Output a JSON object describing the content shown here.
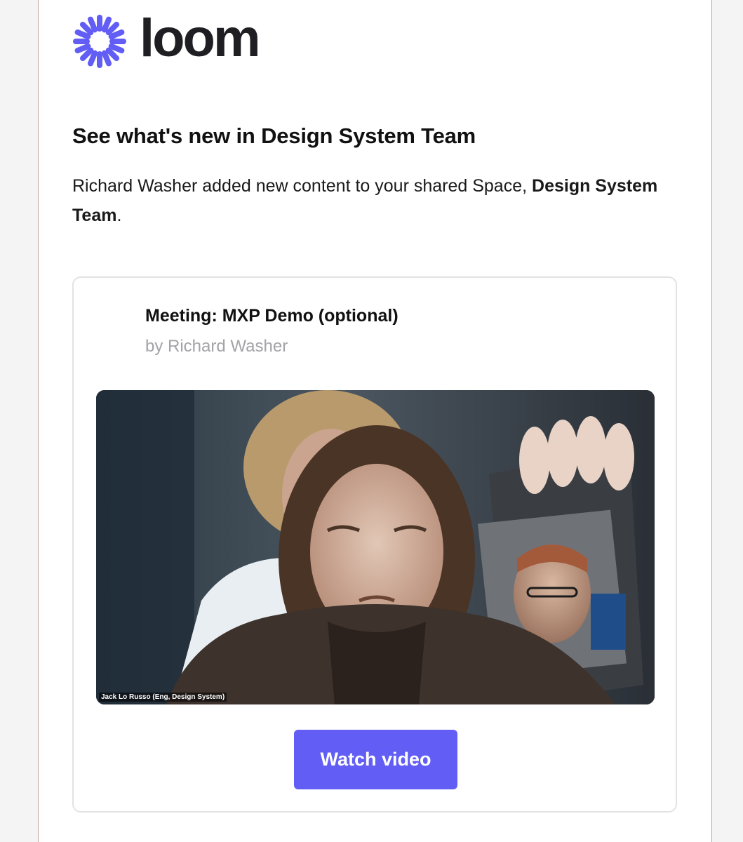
{
  "brand": {
    "name": "loom",
    "accent": "#625df5"
  },
  "email": {
    "headline": "See what's new in Design System Team",
    "intro_prefix": "Richard Washer added new content to your shared Space, ",
    "space_name": "Design System Team",
    "intro_suffix": "."
  },
  "card": {
    "title": "Meeting: MXP Demo (optional)",
    "author": "by Richard Washer",
    "video_caption": "Jack Lo Russo (Eng, Design System)",
    "button_label": "Watch video"
  }
}
